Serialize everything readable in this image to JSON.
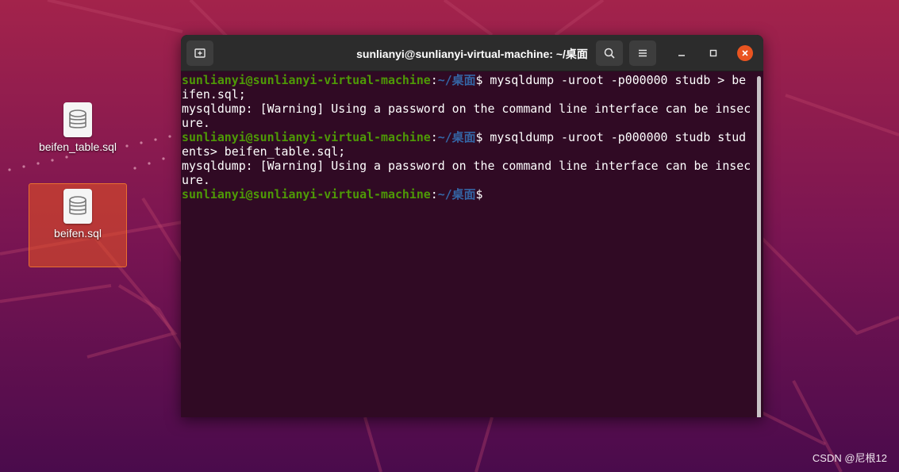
{
  "desktop": {
    "icons": [
      {
        "label": "beifen_table.sql",
        "icon": "database-file-icon",
        "selected": false
      },
      {
        "label": "beifen.sql",
        "icon": "database-file-icon",
        "selected": true
      }
    ],
    "watermark": "CSDN @尼根12"
  },
  "terminal": {
    "title": "sunlianyi@sunlianyi-virtual-machine: ~/桌面",
    "prompt_user": "sunlianyi@sunlianyi-virtual-machine",
    "prompt_colon": ":",
    "prompt_path": "~/桌面",
    "prompt_symbol": "$",
    "lines": [
      {
        "type": "prompt",
        "text": " mysqldump -uroot -p000000 studb > be"
      },
      {
        "type": "output",
        "text": "ifen.sql;"
      },
      {
        "type": "output",
        "text": "mysqldump: [Warning] Using a password on the command line interface can be insec"
      },
      {
        "type": "output",
        "text": "ure."
      },
      {
        "type": "prompt",
        "text": " mysqldump -uroot -p000000 studb stud"
      },
      {
        "type": "output",
        "text": "ents> beifen_table.sql;"
      },
      {
        "type": "output",
        "text": "mysqldump: [Warning] Using a password on the command line interface can be insec"
      },
      {
        "type": "output",
        "text": "ure."
      },
      {
        "type": "prompt",
        "text": ""
      }
    ],
    "buttons": {
      "new_tab": "new-tab-icon",
      "search": "search-icon",
      "menu": "hamburger-menu-icon",
      "minimize": "minimize-icon",
      "maximize": "maximize-icon",
      "close": "close-icon"
    },
    "colors": {
      "background": "#300a24",
      "user": "#4e9a06",
      "path": "#3465a4",
      "close": "#e95420"
    }
  }
}
